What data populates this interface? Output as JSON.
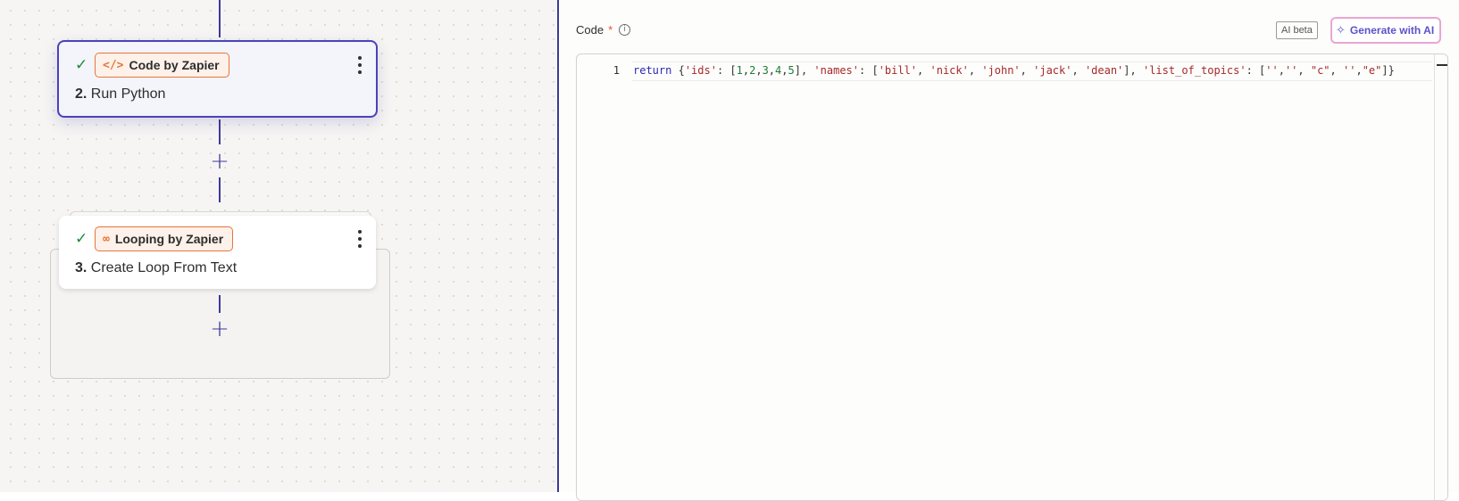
{
  "canvas": {
    "steps": [
      {
        "check": "✓",
        "app": "Code by Zapier",
        "app_icon": "code-icon",
        "number": "2.",
        "title": "Run Python",
        "selected": true
      },
      {
        "check": "✓",
        "app": "Looping by Zapier",
        "app_icon": "loop-icon",
        "number": "3.",
        "title": "Create Loop From Text",
        "selected": false
      }
    ],
    "add_step_glyph": "+"
  },
  "panel": {
    "field_label": "Code",
    "required_mark": "*",
    "info_glyph": "i",
    "ai_beta_label": "AI beta",
    "generate_label": "Generate with AI",
    "editor": {
      "line_number": "1",
      "code": "return {'ids': [1,2,3,4,5], 'names': ['bill', 'nick', 'john', 'jack', 'dean'], 'list_of_topics': ['','', \"c\", '',\"e\"]}"
    }
  },
  "colors": {
    "accent": "#3d3a99",
    "app_badge": "#e7763a",
    "check": "#1e8a3c",
    "required": "#e5532c"
  }
}
